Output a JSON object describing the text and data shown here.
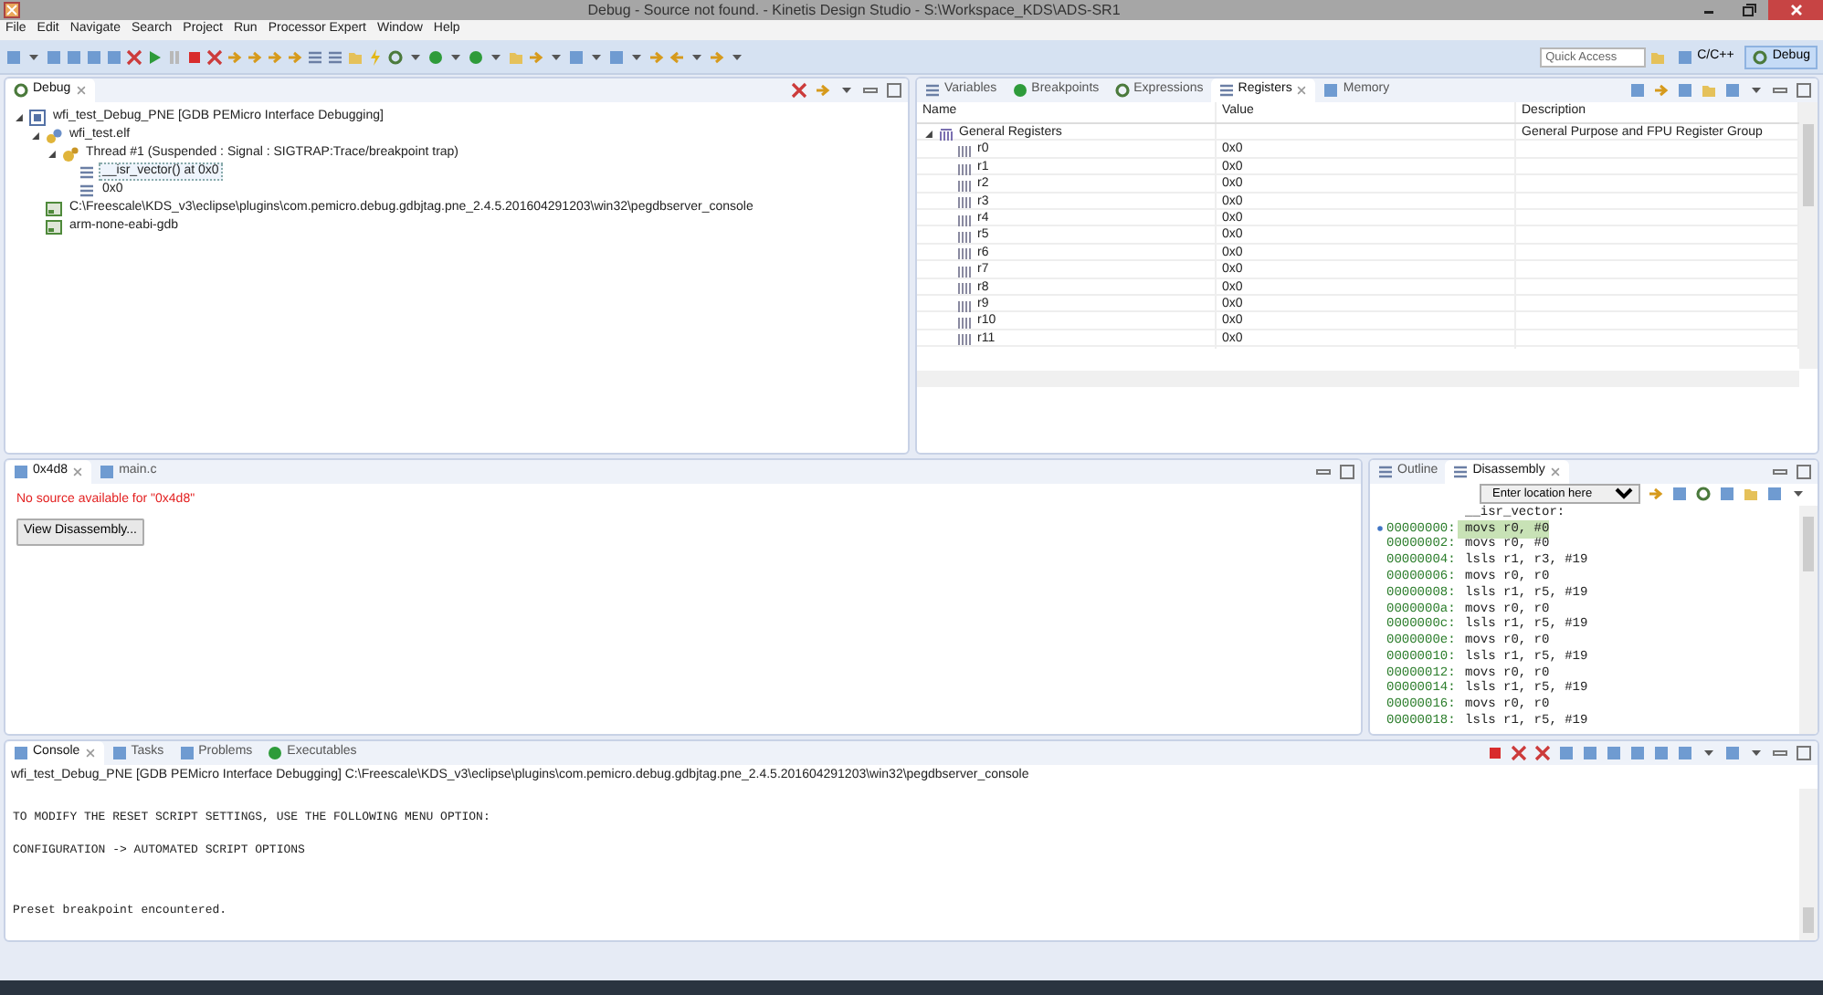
{
  "window": {
    "title": "Debug - Source not found. - Kinetis Design Studio - S:\\Workspace_KDS\\ADS-SR1"
  },
  "menu": [
    "File",
    "Edit",
    "Navigate",
    "Search",
    "Project",
    "Run",
    "Processor Expert",
    "Window",
    "Help"
  ],
  "quick_access": {
    "placeholder": "Quick Access"
  },
  "perspectives": [
    {
      "label": "C/C++",
      "selected": false
    },
    {
      "label": "Debug",
      "selected": true
    }
  ],
  "debug_view": {
    "tabs": [
      {
        "label": "Debug",
        "selected": true
      }
    ],
    "tree": [
      {
        "label": "wfi_test_Debug_PNE [GDB PEMicro Interface Debugging]",
        "kind": "launch",
        "expanded": true,
        "children": [
          {
            "label": "wfi_test.elf",
            "kind": "process",
            "expanded": true,
            "children": [
              {
                "label": "Thread #1 (Suspended : Signal : SIGTRAP:Trace/breakpoint trap)",
                "kind": "thread",
                "expanded": true,
                "children": [
                  {
                    "label": "__isr_vector() at 0x0",
                    "kind": "frame",
                    "selected": true
                  },
                  {
                    "label": "0x0",
                    "kind": "frame",
                    "selected": false
                  }
                ]
              }
            ]
          },
          {
            "label": "C:\\Freescale\\KDS_v3\\eclipse\\plugins\\com.pemicro.debug.gdbjtag.pne_2.4.5.201604291203\\win32\\pegdbserver_console",
            "kind": "console"
          },
          {
            "label": "arm-none-eabi-gdb",
            "kind": "console"
          }
        ]
      }
    ]
  },
  "registers_view": {
    "tabs": [
      {
        "label": "Variables",
        "selected": false
      },
      {
        "label": "Breakpoints",
        "selected": false
      },
      {
        "label": "Expressions",
        "selected": false
      },
      {
        "label": "Registers",
        "selected": true
      },
      {
        "label": "Memory",
        "selected": false
      }
    ],
    "columns": [
      "Name",
      "Value",
      "Description"
    ],
    "rows": [
      {
        "name": "General Registers",
        "description": "General Purpose and FPU Register Group",
        "expanded": true,
        "children": [
          {
            "name": "r0",
            "value": "0x0"
          },
          {
            "name": "r1",
            "value": "0x0"
          },
          {
            "name": "r2",
            "value": "0x0"
          },
          {
            "name": "r3",
            "value": "0x0"
          },
          {
            "name": "r4",
            "value": "0x0"
          },
          {
            "name": "r5",
            "value": "0x0"
          },
          {
            "name": "r6",
            "value": "0x0"
          },
          {
            "name": "r7",
            "value": "0x0"
          },
          {
            "name": "r8",
            "value": "0x0"
          },
          {
            "name": "r9",
            "value": "0x0"
          },
          {
            "name": "r10",
            "value": "0x0"
          },
          {
            "name": "r11",
            "value": "0x0"
          }
        ]
      }
    ]
  },
  "editor": {
    "tabs": [
      {
        "label": "0x4d8",
        "selected": true
      },
      {
        "label": "main.c",
        "selected": false
      }
    ],
    "message": "No source available for \"0x4d8\"",
    "button": "View Disassembly..."
  },
  "disassembly_view": {
    "tabs": [
      {
        "label": "Outline",
        "selected": false
      },
      {
        "label": "Disassembly",
        "selected": true
      }
    ],
    "location": {
      "placeholder": "Enter location here"
    },
    "label": "__isr_vector:",
    "lines": [
      {
        "address": "00000000:",
        "instruction": "movs r0, #0",
        "current": true
      },
      {
        "address": "00000002:",
        "instruction": "movs r0, #0",
        "current": false
      },
      {
        "address": "00000004:",
        "instruction": "lsls r1, r3, #19",
        "current": false
      },
      {
        "address": "00000006:",
        "instruction": "movs r0, r0",
        "current": false
      },
      {
        "address": "00000008:",
        "instruction": "lsls r1, r5, #19",
        "current": false
      },
      {
        "address": "0000000a:",
        "instruction": "movs r0, r0",
        "current": false
      },
      {
        "address": "0000000c:",
        "instruction": "lsls r1, r5, #19",
        "current": false
      },
      {
        "address": "0000000e:",
        "instruction": "movs r0, r0",
        "current": false
      },
      {
        "address": "00000010:",
        "instruction": "lsls r1, r5, #19",
        "current": false
      },
      {
        "address": "00000012:",
        "instruction": "movs r0, r0",
        "current": false
      },
      {
        "address": "00000014:",
        "instruction": "lsls r1, r5, #19",
        "current": false
      },
      {
        "address": "00000016:",
        "instruction": "movs r0, r0",
        "current": false
      },
      {
        "address": "00000018:",
        "instruction": "lsls r1, r5, #19",
        "current": false
      }
    ]
  },
  "console_view": {
    "tabs": [
      {
        "label": "Console",
        "selected": true
      },
      {
        "label": "Tasks",
        "selected": false
      },
      {
        "label": "Problems",
        "selected": false
      },
      {
        "label": "Executables",
        "selected": false
      }
    ],
    "process": "wfi_test_Debug_PNE [GDB PEMicro Interface Debugging] C:\\Freescale\\KDS_v3\\eclipse\\plugins\\com.pemicro.debug.gdbjtag.pne_2.4.5.201604291203\\win32\\pegdbserver_console",
    "output": [
      {
        "text": "TO MODIFY THE RESET SCRIPT SETTINGS, USE THE FOLLOWING MENU OPTION:"
      },
      {
        "text": "CONFIGURATION -> AUTOMATED SCRIPT OPTIONS"
      },
      {
        "text": "Preset breakpoint encountered."
      }
    ]
  }
}
